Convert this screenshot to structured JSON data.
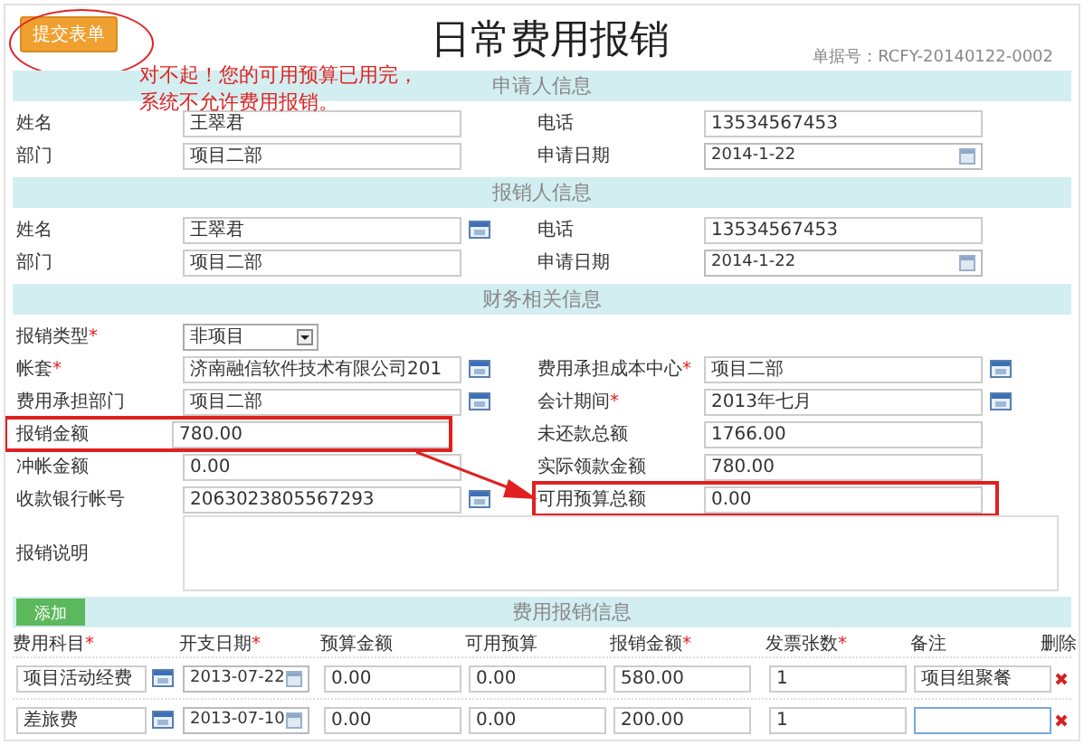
{
  "submit_button": {
    "label": "提交表单"
  },
  "title": "日常费用报销",
  "doc_number": "单据号：RCFY-20140122-0002",
  "warning": [
    "对不起！您的可用预算已用完，",
    "系统不允许费用报销。"
  ],
  "sections": [
    {
      "title": "申请人信息",
      "rows": [
        {
          "left": {
            "label": "姓名",
            "value": "王翠君",
            "kind": "text"
          },
          "right": {
            "label": "电话",
            "value": "13534567453",
            "kind": "text"
          }
        },
        {
          "left": {
            "label": "部门",
            "value": "项目二部",
            "kind": "text"
          },
          "right": {
            "label": "申请日期",
            "value": "2014-1-22",
            "kind": "date"
          }
        }
      ]
    },
    {
      "title": "报销人信息",
      "rows": [
        {
          "left": {
            "label": "姓名",
            "value": "王翠君",
            "kind": "lookup"
          },
          "right": {
            "label": "电话",
            "value": "13534567453",
            "kind": "text"
          }
        },
        {
          "left": {
            "label": "部门",
            "value": "项目二部",
            "kind": "text"
          },
          "right": {
            "label": "申请日期",
            "value": "2014-1-22",
            "kind": "date"
          }
        }
      ]
    },
    {
      "title": "财务相关信息",
      "rows": [
        {
          "left": {
            "label": "报销类型",
            "mark": "*",
            "value": "非项目",
            "kind": "select"
          }
        },
        {
          "left": {
            "label": "帐套",
            "mark": "*",
            "value": "济南融信软件技术有限公司201",
            "kind": "lookup"
          },
          "right": {
            "label": "费用承担成本中心",
            "mark": "*",
            "value": "项目二部",
            "kind": "lookup"
          }
        },
        {
          "left": {
            "label": "费用承担部门",
            "value": "项目二部",
            "kind": "lookup"
          },
          "right": {
            "label": "会计期间",
            "mark": "*",
            "value": "2013年七月",
            "kind": "lookup"
          }
        },
        {
          "left": {
            "label": "报销金额",
            "value": "780.00",
            "kind": "text",
            "highlighted": true
          },
          "right": {
            "label": "未还款总额",
            "value": "1766.00",
            "kind": "text"
          }
        },
        {
          "left": {
            "label": "冲帐金额",
            "value": "0.00",
            "kind": "text"
          },
          "right": {
            "label": "实际领款金额",
            "value": "780.00",
            "kind": "text"
          }
        },
        {
          "left": {
            "label": "收款银行帐号",
            "value": "2063023805567293",
            "kind": "lookup"
          },
          "right": {
            "label": "可用预算总额",
            "value": "0.00",
            "kind": "text",
            "highlighted": true
          }
        }
      ],
      "note": {
        "label": "报销说明"
      }
    }
  ],
  "expenses": {
    "title": "费用报销信息",
    "add_button": "添加",
    "columns": [
      {
        "label": "费用科目",
        "mark": "*"
      },
      {
        "label": "开支日期",
        "mark": "*"
      },
      {
        "label": "预算金额"
      },
      {
        "label": "可用预算"
      },
      {
        "label": "报销金额",
        "mark": "*"
      },
      {
        "label": "发票张数",
        "mark": "*"
      },
      {
        "label": "备注"
      },
      {
        "label": "删除"
      }
    ],
    "rows": [
      {
        "subject": "项目活动经费",
        "date": "2013-07-22",
        "budget": "0.00",
        "available": "0.00",
        "amount": "580.00",
        "invoices": "1",
        "remark": "项目组聚餐",
        "focused": false
      },
      {
        "subject": "差旅费",
        "date": "2013-07-10",
        "budget": "0.00",
        "available": "0.00",
        "amount": "200.00",
        "invoices": "1",
        "focused": true
      }
    ]
  }
}
